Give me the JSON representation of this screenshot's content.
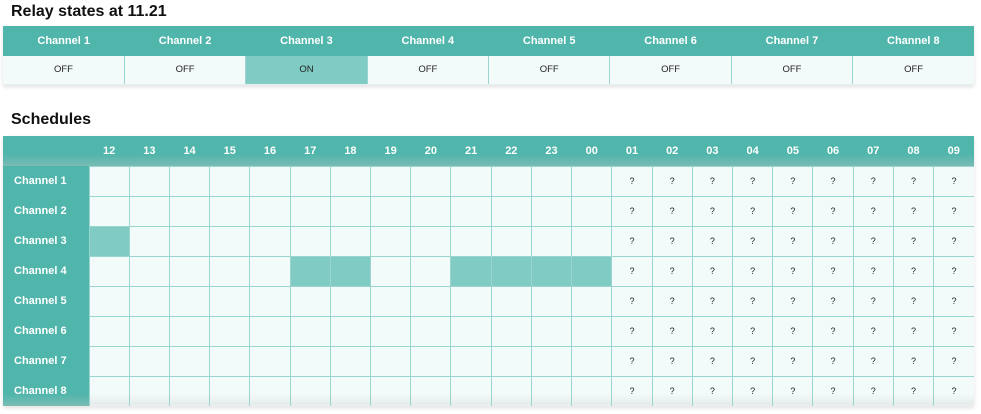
{
  "relay": {
    "title": "Relay states at 11.21",
    "channels": [
      "Channel 1",
      "Channel 2",
      "Channel 3",
      "Channel 4",
      "Channel 5",
      "Channel 6",
      "Channel 7",
      "Channel 8"
    ],
    "states": [
      "OFF",
      "OFF",
      "ON",
      "OFF",
      "OFF",
      "OFF",
      "OFF",
      "OFF"
    ]
  },
  "schedules": {
    "title": "Schedules",
    "hours": [
      "12",
      "13",
      "14",
      "15",
      "16",
      "17",
      "18",
      "19",
      "20",
      "21",
      "22",
      "23",
      "00",
      "01",
      "02",
      "03",
      "04",
      "05",
      "06",
      "07",
      "08",
      "09"
    ],
    "unknown_from_index": 13,
    "unknown_symbol": "?",
    "rows": [
      {
        "channel": "Channel 1",
        "active_hours": []
      },
      {
        "channel": "Channel 2",
        "active_hours": []
      },
      {
        "channel": "Channel 3",
        "active_hours": [
          "12"
        ]
      },
      {
        "channel": "Channel 4",
        "active_hours": [
          "17",
          "18",
          "21",
          "22",
          "23",
          "00"
        ]
      },
      {
        "channel": "Channel 5",
        "active_hours": []
      },
      {
        "channel": "Channel 6",
        "active_hours": []
      },
      {
        "channel": "Channel 7",
        "active_hours": []
      },
      {
        "channel": "Channel 8",
        "active_hours": []
      }
    ]
  },
  "colors": {
    "header": "#50b5ab",
    "active": "#80cbc4",
    "cell": "#f3fbfa"
  }
}
